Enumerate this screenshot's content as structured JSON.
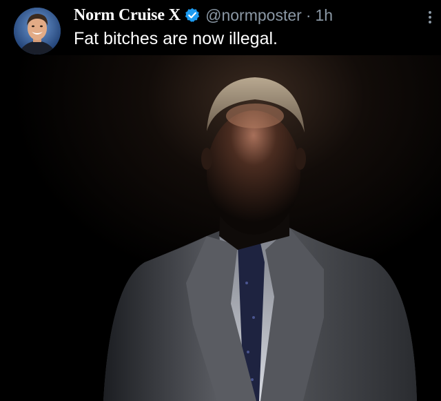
{
  "tweet": {
    "display_name": "Norm Cruise",
    "name_suffix": "X",
    "handle": "@normposter",
    "separator": "·",
    "time": "1h",
    "text": "Fat bitches are now illegal."
  },
  "icons": {
    "verified": "verified-badge-icon",
    "more": "more-options-icon"
  },
  "colors": {
    "background": "#000000",
    "text_primary": "#ffffff",
    "text_secondary": "#8b98a5",
    "verified_blue": "#1d9bf0"
  }
}
